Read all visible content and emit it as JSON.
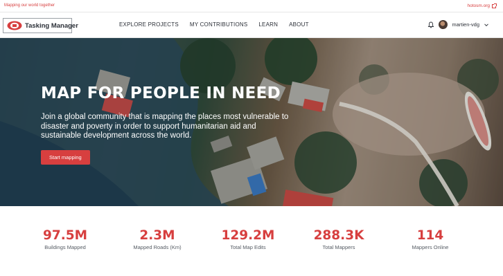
{
  "top_strip": {
    "tagline": "Mapping our world together",
    "hot_link": "hotosm.org"
  },
  "header": {
    "logo_text": "Tasking Manager",
    "nav": [
      {
        "label": "EXPLORE PROJECTS"
      },
      {
        "label": "MY CONTRIBUTIONS"
      },
      {
        "label": "LEARN"
      },
      {
        "label": "ABOUT"
      }
    ],
    "username": "martien-vdg"
  },
  "hero": {
    "title": "MAP FOR PEOPLE IN NEED",
    "description": "Join a global community that is mapping the places most vulnerable to disaster and poverty in order to support humanitarian aid and sustainable development across the world.",
    "cta": "Start mapping"
  },
  "stats": [
    {
      "value": "97.5M",
      "label": "Buildings Mapped"
    },
    {
      "value": "2.3M",
      "label": "Mapped Roads (Km)"
    },
    {
      "value": "129.2M",
      "label": "Total Map Edits"
    },
    {
      "value": "288.3K",
      "label": "Total Mappers"
    },
    {
      "value": "114",
      "label": "Mappers Online"
    }
  ],
  "colors": {
    "accent": "#d73f3f",
    "text": "#2c3038"
  },
  "icons": [
    "external-link-icon",
    "hot-logo-icon",
    "bell-icon",
    "avatar",
    "chevron-down-icon"
  ]
}
